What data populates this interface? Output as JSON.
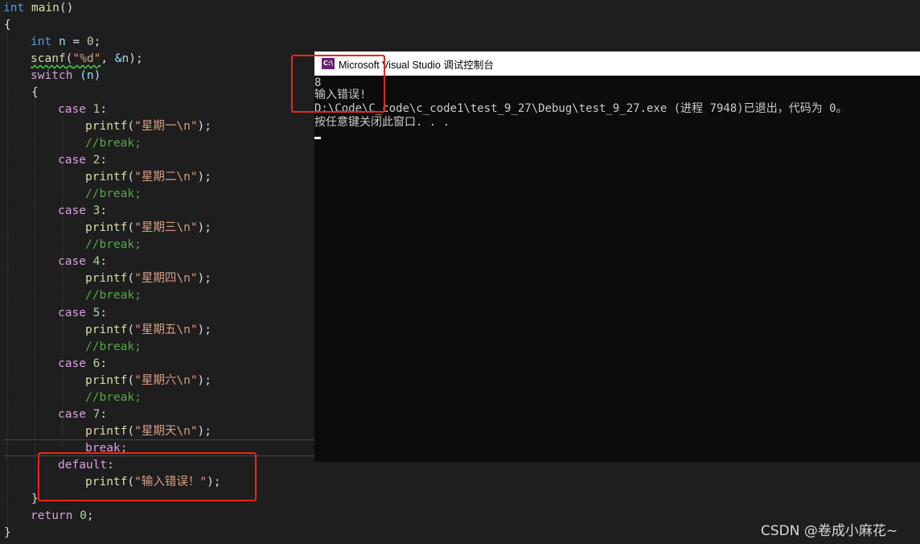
{
  "editor": {
    "line_main": {
      "type": "int",
      "name": "main",
      "parens": "()"
    },
    "brace_open": "{",
    "line_decl": {
      "type": "int",
      "var": "n",
      "eq": " = ",
      "zero": "0",
      "end": ";"
    },
    "line_scanf": {
      "fn": "scanf",
      "open": "(",
      "fmt": "\"%d\"",
      "comma": ", ",
      "amp": "&n",
      "close": ");"
    },
    "line_switch": {
      "kw": "switch",
      "arg": " (n)"
    },
    "inner_brace_open": "{",
    "cases": [
      {
        "kw": "case",
        "num": "1",
        "colon": ":",
        "str": "\"星期一\\n\"",
        "comment": "//break;"
      },
      {
        "kw": "case",
        "num": "2",
        "colon": ":",
        "str": "\"星期二\\n\"",
        "comment": "//break;"
      },
      {
        "kw": "case",
        "num": "3",
        "colon": ":",
        "str": "\"星期三\\n\"",
        "comment": "//break;"
      },
      {
        "kw": "case",
        "num": "4",
        "colon": ":",
        "str": "\"星期四\\n\"",
        "comment": "//break;"
      },
      {
        "kw": "case",
        "num": "5",
        "colon": ":",
        "str": "\"星期五\\n\"",
        "comment": "//break;"
      },
      {
        "kw": "case",
        "num": "6",
        "colon": ":",
        "str": "\"星期六\\n\"",
        "comment": "//break;"
      },
      {
        "kw": "case",
        "num": "7",
        "colon": ":",
        "str": "\"星期天\\n\"",
        "comment": "break;"
      }
    ],
    "printf": {
      "fn": "printf",
      "open": "(",
      "close": ");"
    },
    "default_line": {
      "kw": "default",
      "colon": ":"
    },
    "default_printf": {
      "str": "\"输入错误！\""
    },
    "inner_brace_close": "}",
    "return_line": {
      "kw": "return",
      "num": "0",
      "end": ";"
    },
    "brace_close": "}"
  },
  "console": {
    "title": "Microsoft Visual Studio 调试控制台",
    "icon_text": "C:\\",
    "lines": [
      "8",
      "输入错误!",
      "D:\\Code\\C_code\\c_code1\\test_9_27\\Debug\\test_9_27.exe (进程 7948)已退出，代码为 0。",
      "按任意键关闭此窗口. . ."
    ]
  },
  "watermark": "CSDN @卷成小麻花~",
  "colors": {
    "editor_bg": "#1e1e1e",
    "console_bg": "#0c0c0c",
    "keyword": "#569cd6",
    "control": "#d8a0df",
    "function": "#dcdcaa",
    "string": "#d69d85",
    "comment": "#57a64a",
    "highlight_box": "#e8261a"
  }
}
